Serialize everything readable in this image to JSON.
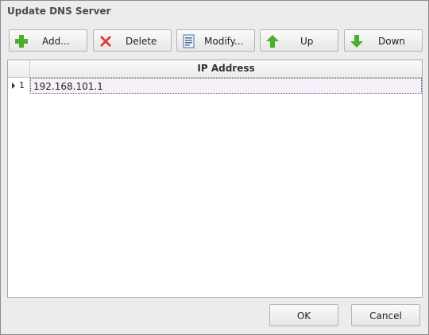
{
  "window": {
    "title": "Update DNS Server"
  },
  "toolbar": {
    "add_label": "Add...",
    "delete_label": "Delete",
    "modify_label": "Modify...",
    "up_label": "Up",
    "down_label": "Down"
  },
  "grid": {
    "column_header": "IP Address",
    "rows": [
      {
        "index": "1",
        "ip": "192.168.101.1"
      }
    ]
  },
  "footer": {
    "ok_label": "OK",
    "cancel_label": "Cancel"
  },
  "colors": {
    "add_icon": "#4caf2a",
    "delete_icon": "#e23b3b",
    "up_icon": "#4caf2a",
    "down_icon": "#4caf2a",
    "selected_row": "#f6f0fb"
  }
}
